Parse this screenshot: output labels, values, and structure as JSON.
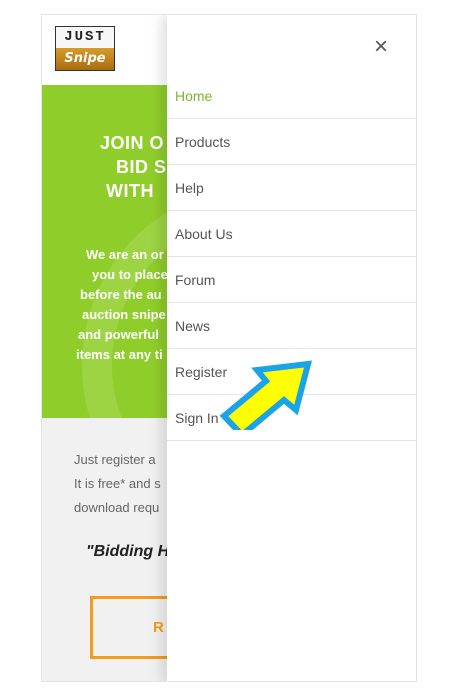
{
  "logo": {
    "line1": "JUST",
    "line2": "Snipe"
  },
  "hero": {
    "title_lines": [
      "JOIN O",
      "BID S",
      "WITH"
    ],
    "para_lines": [
      "We are an or",
      "you to place",
      "before the au",
      "auction snipe",
      "and powerful",
      "items at any ti"
    ]
  },
  "content": {
    "lines": [
      "Just register a",
      "It is free* and s",
      "download requ"
    ],
    "quote": "\"Bidding H",
    "cta_label": "R"
  },
  "drawer": {
    "close_label": "×",
    "menu": [
      {
        "label": "Home",
        "active": true
      },
      {
        "label": "Products"
      },
      {
        "label": "Help"
      },
      {
        "label": "About Us"
      },
      {
        "label": "Forum"
      },
      {
        "label": "News"
      },
      {
        "label": "Register"
      },
      {
        "label": "Sign In"
      }
    ]
  },
  "colors": {
    "accent_green": "#8fce2a",
    "menu_active": "#7ab62a",
    "cta_orange": "#f29b1d",
    "arrow_fill": "#ffff00",
    "arrow_border": "#1aa3e8"
  }
}
